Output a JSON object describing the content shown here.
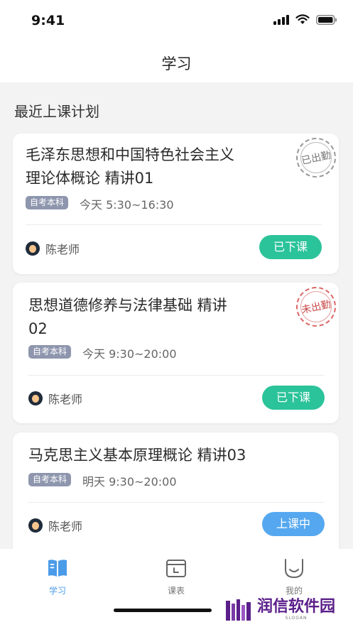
{
  "status_bar": {
    "time": "9:41"
  },
  "nav": {
    "title": "学习"
  },
  "section": {
    "title": "最近上课计划"
  },
  "cards": [
    {
      "title_line1": "毛泽东思想和中国特色社会主义",
      "title_line2": "理论体概论 精讲01",
      "tag": "自考本科",
      "time": "今天 5:30~16:30",
      "teacher": "陈老师",
      "button": "已下课",
      "stamp": "已出勤"
    },
    {
      "title_line1": "思想道德修养与法律基础 精讲",
      "title_line2": "02",
      "tag": "自考本科",
      "time": "今天 9:30~20:00",
      "teacher": "陈老师",
      "button": "已下课",
      "stamp": "未出勤"
    },
    {
      "title_line1": "马克思主义基本原理概论 精讲03",
      "tag": "自考本科",
      "time": "明天 9:30~20:00",
      "teacher": "陈老师",
      "button": "上课中"
    }
  ],
  "tabbar": {
    "items": [
      {
        "label": "学习",
        "icon": "book-icon",
        "active": true
      },
      {
        "label": "课表",
        "icon": "calendar-icon",
        "active": false
      },
      {
        "label": "我的",
        "icon": "smile-icon",
        "active": false
      }
    ]
  },
  "watermark": {
    "text": "润信软件园",
    "sub": "SLOGAN"
  },
  "colors": {
    "green": "#2bc39a",
    "blue": "#55a8f0",
    "tag": "#8e96ae",
    "active_tab": "#4a9be8"
  }
}
